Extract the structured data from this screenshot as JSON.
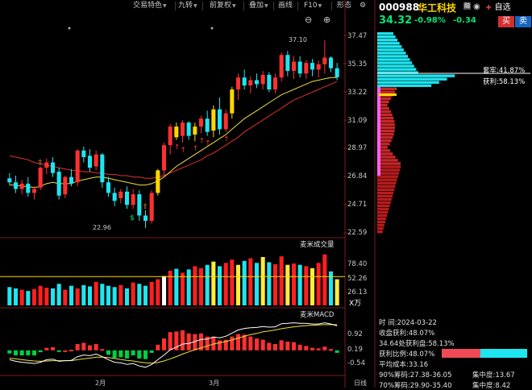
{
  "toolbar": {
    "buttons": [
      "交易特色",
      "九转",
      "前复权",
      "叠加",
      "画线",
      "F10",
      "形态"
    ],
    "settings_icon": "gear-icon",
    "zoom_in_icon": "plus-icon",
    "zoom_out_icon": "minus-icon"
  },
  "stock": {
    "code": "000988",
    "name": "华工科技",
    "badge": "融",
    "price": "34.32",
    "change_pct": "-0.98%",
    "change": "-0.34",
    "buy_label": "买",
    "sell_label": "卖",
    "watchlist_label": "自选"
  },
  "price_axis": {
    "ticks": [
      "37.47",
      "35.35",
      "33.22",
      "31.09",
      "28.97",
      "26.84",
      "24.71",
      "22.59"
    ],
    "high_label": "37.10",
    "low_label": "22.96"
  },
  "volume_panel": {
    "title": "麦米成交量",
    "ticks": [
      "78.40",
      "52.26",
      "26.13"
    ],
    "unit": "X万"
  },
  "macd_panel": {
    "title": "麦米MACD",
    "ticks": [
      "0.92",
      "0.19",
      "-0.54"
    ]
  },
  "time_axis": {
    "labels": [
      "2月",
      "3月",
      "日线"
    ]
  },
  "chip": {
    "trap_label": "套牢:41.87%",
    "profit_label": "获利:58.13%"
  },
  "chip_info": {
    "time": "时      间:2024-03-22",
    "close_profit": "收盘获利:48.07%",
    "price_profit": "34.64处获利盘:58.13%",
    "profit_ratio": "获利比例:48.07%",
    "avg_cost": "平均成本:33.16",
    "chip90": "90%筹码:27.38-36.05",
    "conc90": "集中度:13.67",
    "chip70": "70%筹码:29.90-35.40",
    "conc70": "集中度:8.42"
  },
  "chart_data": {
    "type": "candlestick",
    "ylim": [
      22.59,
      37.47
    ],
    "candles": [
      {
        "o": 26.7,
        "h": 27.1,
        "l": 26.2,
        "c": 26.4
      },
      {
        "o": 26.4,
        "h": 26.9,
        "l": 25.6,
        "c": 25.9
      },
      {
        "o": 25.9,
        "h": 26.6,
        "l": 25.5,
        "c": 26.3
      },
      {
        "o": 26.3,
        "h": 26.8,
        "l": 25.3,
        "c": 25.6
      },
      {
        "o": 25.6,
        "h": 26.1,
        "l": 25.1,
        "c": 25.9
      },
      {
        "o": 26.0,
        "h": 27.6,
        "l": 25.8,
        "c": 27.5
      },
      {
        "o": 27.5,
        "h": 28.2,
        "l": 27.0,
        "c": 27.9
      },
      {
        "o": 27.9,
        "h": 28.3,
        "l": 26.8,
        "c": 27.1
      },
      {
        "o": 27.2,
        "h": 27.5,
        "l": 25.1,
        "c": 25.4
      },
      {
        "o": 25.5,
        "h": 26.9,
        "l": 25.2,
        "c": 26.8
      },
      {
        "o": 26.8,
        "h": 27.4,
        "l": 26.1,
        "c": 26.3
      },
      {
        "o": 26.4,
        "h": 28.9,
        "l": 26.1,
        "c": 28.8
      },
      {
        "o": 28.8,
        "h": 29.1,
        "l": 27.9,
        "c": 28.3
      },
      {
        "o": 28.4,
        "h": 28.9,
        "l": 27.2,
        "c": 27.5
      },
      {
        "o": 27.6,
        "h": 28.8,
        "l": 27.3,
        "c": 28.5
      },
      {
        "o": 28.5,
        "h": 28.6,
        "l": 26.0,
        "c": 26.4
      },
      {
        "o": 26.4,
        "h": 26.8,
        "l": 25.3,
        "c": 25.6
      },
      {
        "o": 25.6,
        "h": 26.0,
        "l": 24.6,
        "c": 25.0
      },
      {
        "o": 25.2,
        "h": 25.9,
        "l": 24.8,
        "c": 25.7
      },
      {
        "o": 25.7,
        "h": 26.1,
        "l": 24.4,
        "c": 24.7
      },
      {
        "o": 24.7,
        "h": 25.9,
        "l": 24.4,
        "c": 25.5
      },
      {
        "o": 25.5,
        "h": 25.8,
        "l": 23.5,
        "c": 23.9
      },
      {
        "o": 23.9,
        "h": 24.3,
        "l": 22.96,
        "c": 23.5
      },
      {
        "o": 23.5,
        "h": 25.8,
        "l": 23.3,
        "c": 25.6
      },
      {
        "o": 25.6,
        "h": 27.4,
        "l": 25.4,
        "c": 27.3
      },
      {
        "o": 27.3,
        "h": 29.4,
        "l": 26.9,
        "c": 29.2
      },
      {
        "o": 29.2,
        "h": 30.8,
        "l": 28.5,
        "c": 30.6
      },
      {
        "o": 30.6,
        "h": 30.9,
        "l": 29.6,
        "c": 29.8
      },
      {
        "o": 29.9,
        "h": 31.1,
        "l": 29.4,
        "c": 30.9
      },
      {
        "o": 30.9,
        "h": 31.0,
        "l": 29.6,
        "c": 29.9
      },
      {
        "o": 30.0,
        "h": 30.9,
        "l": 29.5,
        "c": 30.6
      },
      {
        "o": 30.6,
        "h": 31.4,
        "l": 30.1,
        "c": 31.2
      },
      {
        "o": 31.2,
        "h": 31.8,
        "l": 29.9,
        "c": 30.2
      },
      {
        "o": 30.3,
        "h": 32.2,
        "l": 29.8,
        "c": 31.9
      },
      {
        "o": 31.9,
        "h": 32.8,
        "l": 30.0,
        "c": 30.4
      },
      {
        "o": 30.4,
        "h": 31.9,
        "l": 30.2,
        "c": 31.6
      },
      {
        "o": 31.6,
        "h": 33.6,
        "l": 31.2,
        "c": 33.4
      },
      {
        "o": 33.4,
        "h": 34.6,
        "l": 32.6,
        "c": 34.3
      },
      {
        "o": 34.3,
        "h": 34.9,
        "l": 33.4,
        "c": 33.7
      },
      {
        "o": 33.7,
        "h": 34.4,
        "l": 33.1,
        "c": 34.1
      },
      {
        "o": 34.1,
        "h": 34.6,
        "l": 33.5,
        "c": 33.8
      },
      {
        "o": 33.8,
        "h": 34.8,
        "l": 33.4,
        "c": 34.5
      },
      {
        "o": 34.5,
        "h": 34.7,
        "l": 33.2,
        "c": 33.4
      },
      {
        "o": 33.4,
        "h": 34.6,
        "l": 33.1,
        "c": 34.3
      },
      {
        "o": 34.3,
        "h": 36.2,
        "l": 34.0,
        "c": 36.0
      },
      {
        "o": 36.0,
        "h": 36.3,
        "l": 34.4,
        "c": 34.8
      },
      {
        "o": 34.8,
        "h": 35.9,
        "l": 34.2,
        "c": 35.5
      },
      {
        "o": 35.5,
        "h": 35.9,
        "l": 34.3,
        "c": 34.6
      },
      {
        "o": 34.6,
        "h": 35.6,
        "l": 34.2,
        "c": 35.4
      },
      {
        "o": 35.4,
        "h": 35.7,
        "l": 34.4,
        "c": 34.9
      },
      {
        "o": 34.9,
        "h": 35.6,
        "l": 34.3,
        "c": 35.3
      },
      {
        "o": 35.3,
        "h": 37.1,
        "l": 34.6,
        "c": 35.8
      },
      {
        "o": 35.8,
        "h": 35.9,
        "l": 34.7,
        "c": 35.0
      },
      {
        "o": 35.0,
        "h": 35.4,
        "l": 34.1,
        "c": 34.32
      }
    ],
    "ma_fast": [
      26.2,
      26.2,
      26.1,
      26.1,
      26.0,
      26.1,
      26.3,
      26.4,
      26.3,
      26.3,
      26.3,
      26.5,
      26.6,
      26.7,
      26.8,
      26.8,
      26.7,
      26.6,
      26.5,
      26.4,
      26.3,
      26.2,
      26.2,
      26.3,
      26.5,
      26.8,
      27.2,
      27.6,
      27.9,
      28.2,
      28.5,
      28.8,
      29.1,
      29.4,
      29.7,
      30.0,
      30.4,
      30.8,
      31.2,
      31.5,
      31.8,
      32.1,
      32.4,
      32.7,
      33.0,
      33.2,
      33.4,
      33.6,
      33.8,
      34.0,
      34.1,
      34.2,
      34.3,
      34.3
    ],
    "ma_slow": [
      28.4,
      28.3,
      28.2,
      28.1,
      27.9,
      27.8,
      27.7,
      27.6,
      27.5,
      27.4,
      27.3,
      27.3,
      27.2,
      27.2,
      27.1,
      27.1,
      27.0,
      27.0,
      26.9,
      26.9,
      26.8,
      26.8,
      26.7,
      26.7,
      26.8,
      26.9,
      27.1,
      27.3,
      27.5,
      27.7,
      27.9,
      28.1,
      28.4,
      28.6,
      28.9,
      29.2,
      29.5,
      29.8,
      30.2,
      30.5,
      30.8,
      31.1,
      31.4,
      31.7,
      32.0,
      32.3,
      32.6,
      32.8,
      33.0,
      33.2,
      33.4,
      33.6,
      33.8,
      34.0
    ],
    "volume": [
      28,
      26,
      24,
      22,
      25,
      30,
      27,
      26,
      33,
      24,
      30,
      26,
      31,
      29,
      36,
      33,
      30,
      28,
      31,
      26,
      35,
      33,
      30,
      36,
      40,
      45,
      53,
      56,
      50,
      55,
      60,
      57,
      62,
      67,
      60,
      65,
      70,
      62,
      68,
      72,
      65,
      74,
      66,
      63,
      75,
      62,
      64,
      62,
      60,
      57,
      65,
      78,
      52,
      40
    ],
    "volume_ylim": [
      0,
      90
    ],
    "macd_dif": [
      -0.3,
      -0.35,
      -0.38,
      -0.4,
      -0.42,
      -0.38,
      -0.3,
      -0.28,
      -0.35,
      -0.33,
      -0.32,
      -0.2,
      -0.15,
      -0.17,
      -0.12,
      -0.2,
      -0.3,
      -0.38,
      -0.4,
      -0.45,
      -0.42,
      -0.5,
      -0.54,
      -0.45,
      -0.3,
      -0.15,
      0.02,
      0.1,
      0.2,
      0.22,
      0.28,
      0.35,
      0.36,
      0.42,
      0.4,
      0.45,
      0.55,
      0.65,
      0.7,
      0.72,
      0.73,
      0.76,
      0.74,
      0.75,
      0.85,
      0.86,
      0.88,
      0.86,
      0.86,
      0.84,
      0.84,
      0.88,
      0.84,
      0.78
    ],
    "macd_dea": [
      -0.25,
      -0.27,
      -0.3,
      -0.32,
      -0.34,
      -0.35,
      -0.34,
      -0.33,
      -0.33,
      -0.33,
      -0.33,
      -0.3,
      -0.27,
      -0.25,
      -0.22,
      -0.22,
      -0.23,
      -0.26,
      -0.29,
      -0.32,
      -0.34,
      -0.37,
      -0.4,
      -0.41,
      -0.39,
      -0.34,
      -0.27,
      -0.2,
      -0.12,
      -0.05,
      0.02,
      0.08,
      0.14,
      0.2,
      0.24,
      0.28,
      0.33,
      0.39,
      0.45,
      0.5,
      0.54,
      0.59,
      0.62,
      0.65,
      0.69,
      0.72,
      0.75,
      0.77,
      0.79,
      0.8,
      0.81,
      0.82,
      0.82,
      0.82
    ],
    "macd_ylim": [
      -0.7,
      1.1
    ]
  }
}
